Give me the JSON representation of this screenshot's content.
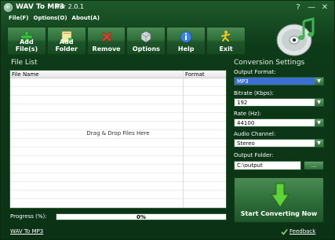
{
  "window": {
    "title": "WAV To MP3",
    "version": "Ver 2.0.1",
    "controls": {
      "help": "?",
      "minimize": "—",
      "close": "✕"
    }
  },
  "menu": {
    "file": "File(F)",
    "options": "Options(O)",
    "about": "About(A)"
  },
  "toolbar": {
    "items": [
      {
        "label": "Add File(s)",
        "icon": "add-icon"
      },
      {
        "label": "Add Folder",
        "icon": "folder-icon"
      },
      {
        "label": "Remove",
        "icon": "remove-icon"
      },
      {
        "label": "Options",
        "icon": "options-icon"
      },
      {
        "label": "Help",
        "icon": "help-icon"
      },
      {
        "label": "Exit",
        "icon": "exit-icon"
      }
    ]
  },
  "file_list": {
    "title": "File List",
    "columns": [
      "File Name",
      "Format"
    ],
    "drop_hint": "Drag & Drop Files Here"
  },
  "progress": {
    "label": "Progress (%):",
    "value": 0,
    "text": "0%"
  },
  "settings": {
    "title": "Conversion Settings",
    "output_format": {
      "label": "Output Format:",
      "value": "MP3"
    },
    "bitrate": {
      "label": "Bitrate (Kbps):",
      "value": "192"
    },
    "rate": {
      "label": "Rate (Hz):",
      "value": "44100"
    },
    "channel": {
      "label": "Audio Channel:",
      "value": "Stereo"
    },
    "folder": {
      "label": "Output Folder:",
      "value": "C:\\output",
      "browse": "..."
    },
    "convert": "Start Converting Now"
  },
  "footer": {
    "link": "WAV To MP3",
    "feedback": "Feedback"
  },
  "colors": {
    "window_bg": "#0d3a18",
    "accent_green": "#3fb34f",
    "selected_blue": "#3b6fd1"
  }
}
